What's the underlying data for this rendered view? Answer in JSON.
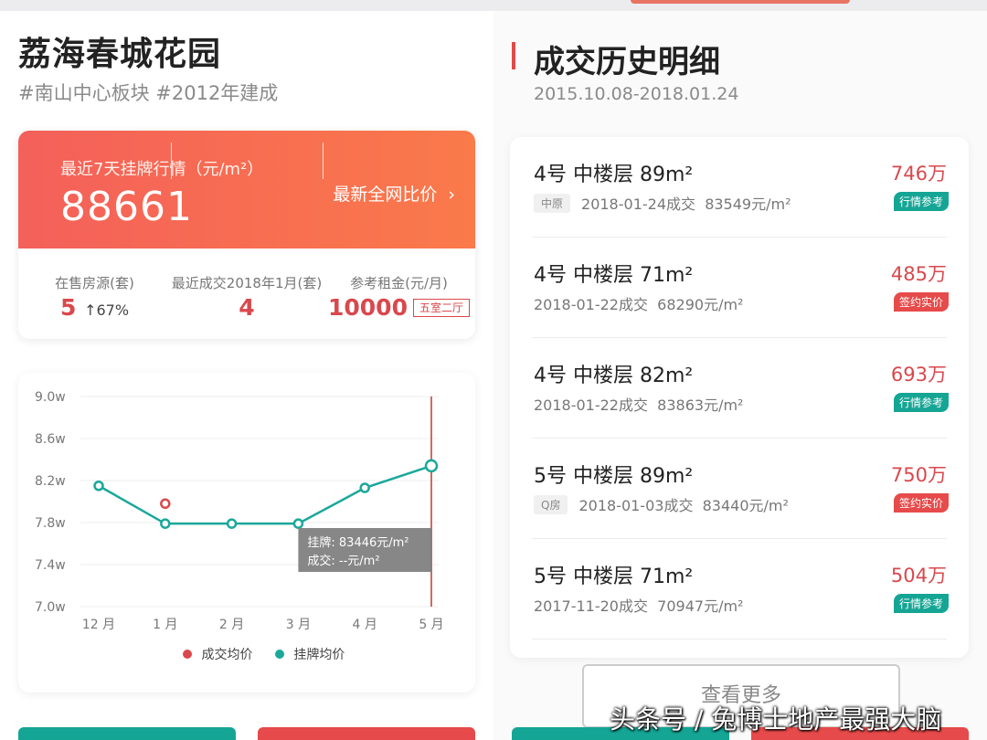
{
  "estate": {
    "name": "荔海春城花园",
    "tags": "#南山中心板块 #2012年建成"
  },
  "listing_banner": {
    "label": "最近7天挂牌行情（元/m²）",
    "price": "88661",
    "compare_link": "最新全网比价",
    "chevron": "chevron-right-icon"
  },
  "stats": [
    {
      "label": "在售房源(套)",
      "value": "5",
      "sub": "↑67%"
    },
    {
      "label": "最近成交2018年1月(套)",
      "value": "4"
    },
    {
      "label": "参考租金(元/月)",
      "value": "10000",
      "tag": "五室二厅"
    }
  ],
  "chart_data": {
    "type": "line",
    "categories": [
      "12 月",
      "1 月",
      "2 月",
      "3 月",
      "4 月",
      "5 月"
    ],
    "yticks": [
      "9.0w",
      "8.6w",
      "8.2w",
      "7.8w",
      "7.4w",
      "7.0w"
    ],
    "ylim": [
      7.0,
      9.0
    ],
    "series": [
      {
        "name": "挂牌均价",
        "color": "#1aa89a",
        "values": [
          8.15,
          7.79,
          7.79,
          7.79,
          8.13,
          8.34
        ]
      },
      {
        "name": "成交均价",
        "color": "#d9484d",
        "values": [
          null,
          7.98,
          null,
          null,
          null,
          null
        ]
      }
    ],
    "grid": true,
    "legend": "bottom",
    "tooltip": {
      "line1": "挂牌: 83446元/m²",
      "line2": "成交: --元/m²"
    }
  },
  "legend_labels": [
    "成交均价",
    "挂牌均价"
  ],
  "history": {
    "title": "成交历史明细",
    "date_range": "2015.10.08-2018.01.24",
    "deals": [
      {
        "title": "4号 中楼层 89m²",
        "source": "中原",
        "date": "2018-01-24成交",
        "unit_price": "83549元/m²",
        "price": "746万",
        "tag": "行情参考",
        "tag_color": "#15a595"
      },
      {
        "title": "4号 中楼层 71m²",
        "source": "",
        "date": "2018-01-22成交",
        "unit_price": "68290元/m²",
        "price": "485万",
        "tag": "签约实价",
        "tag_color": "#e64a4a"
      },
      {
        "title": "4号 中楼层 82m²",
        "source": "",
        "date": "2018-01-22成交",
        "unit_price": "83863元/m²",
        "price": "693万",
        "tag": "行情参考",
        "tag_color": "#15a595"
      },
      {
        "title": "5号 中楼层 89m²",
        "source": "Q房",
        "date": "2018-01-03成交",
        "unit_price": "83440元/m²",
        "price": "750万",
        "tag": "签约实价",
        "tag_color": "#e64a4a"
      },
      {
        "title": "5号 中楼层 71m²",
        "source": "",
        "date": "2017-11-20成交",
        "unit_price": "70947元/m²",
        "price": "504万",
        "tag": "行情参考",
        "tag_color": "#15a595"
      }
    ],
    "more_button": "查看更多"
  },
  "watermark": "头条号 / 兔博士地产最强大脑",
  "colors": {
    "accent_red": "#d9484d",
    "accent_teal": "#1aa89a"
  }
}
